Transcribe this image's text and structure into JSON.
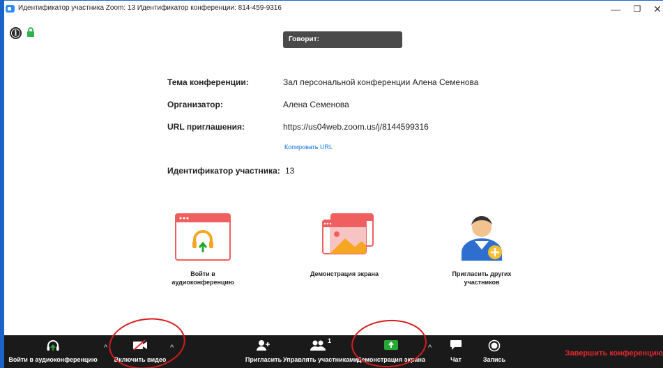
{
  "window": {
    "title": "Идентификатор участника Zoom: 13   Идентификатор конференции: 814-459-9316",
    "minimize": "—",
    "restore": "❐",
    "close": "✕"
  },
  "status": {
    "info_icon": "info-icon",
    "lock_icon": "lock-icon"
  },
  "speaking": {
    "label": "Говорит:"
  },
  "meeting": {
    "topic_label": "Тема конференции:",
    "topic_value": "Зал персональной конференции Алена Семенова",
    "host_label": "Организатор:",
    "host_value": "Алена Семенова",
    "url_label": "URL приглашения:",
    "url_value": "https://us04web.zoom.us/j/8144599316",
    "copy_url": "Копировать URL",
    "participant_id_label": "Идентификатор участника:",
    "participant_id_value": "13"
  },
  "actions": [
    {
      "label_line1": "Войти в",
      "label_line2": "аудиоконференцию",
      "icon": "headphones-icon"
    },
    {
      "label_line1": "Демонстрация экрана",
      "label_line2": "",
      "icon": "share-screen-icon"
    },
    {
      "label_line1": "Пригласить других",
      "label_line2": "участников",
      "icon": "invite-person-icon"
    }
  ],
  "toolbar": {
    "join_audio": "Войти в аудиоконференцию",
    "start_video": "Включить видео",
    "invite": "Пригласить",
    "manage_participants": "Управлять участниками",
    "participants_count": "1",
    "share_screen": "Демонстрация экрана",
    "chat": "Чат",
    "record": "Запись",
    "end": "Завершить конференцию",
    "caret": "^"
  },
  "colors": {
    "accent": "#0e72ed",
    "card": "#f05f5f",
    "share_green": "#27a834",
    "end_red": "#e0282e",
    "annotation": "#d81b1b"
  }
}
